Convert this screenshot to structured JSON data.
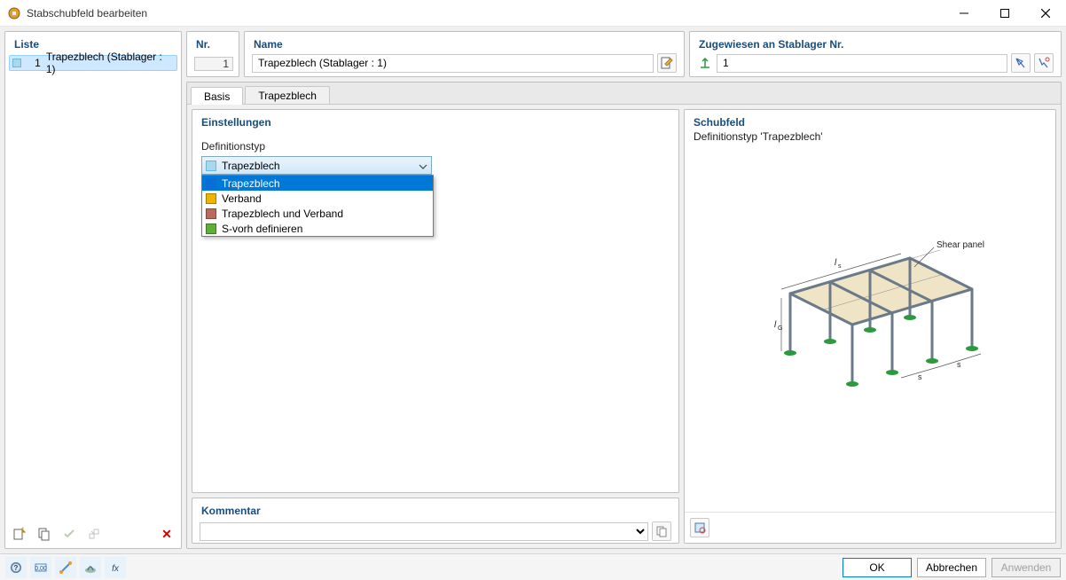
{
  "window": {
    "title": "Stabschubfeld bearbeiten"
  },
  "sidebar": {
    "title": "Liste",
    "items": [
      {
        "num": "1",
        "label": "Trapezblech (Stablager : 1)",
        "selected": true
      }
    ]
  },
  "header": {
    "nr": {
      "label": "Nr.",
      "value": "1"
    },
    "name": {
      "label": "Name",
      "value": "Trapezblech (Stablager : 1)"
    },
    "assigned": {
      "label": "Zugewiesen an Stablager Nr.",
      "value": "1"
    }
  },
  "tabs": {
    "items": [
      {
        "id": "basis",
        "label": "Basis",
        "active": true
      },
      {
        "id": "trapez",
        "label": "Trapezblech",
        "active": false
      }
    ]
  },
  "settings": {
    "title": "Einstellungen",
    "definition_label": "Definitionstyp",
    "combo_selected": "Trapezblech",
    "options": [
      {
        "label": "Trapezblech",
        "color": "#0b6dd6",
        "highlighted": true
      },
      {
        "label": "Verband",
        "color": "#f0b400",
        "highlighted": false
      },
      {
        "label": "Trapezblech und Verband",
        "color": "#bb6b5e",
        "highlighted": false
      },
      {
        "label": "S-vorh definieren",
        "color": "#5fae35",
        "highlighted": false
      }
    ]
  },
  "comment": {
    "title": "Kommentar",
    "value": ""
  },
  "preview": {
    "title": "Schubfeld",
    "subtitle": "Definitionstyp 'Trapezblech'",
    "annotation": "Shear panel"
  },
  "footer": {
    "ok": "OK",
    "cancel": "Abbrechen",
    "apply": "Anwenden"
  },
  "colors": {
    "accent": "#0078d7",
    "panel_title": "#1a4c7a",
    "delete": "#d40000"
  }
}
